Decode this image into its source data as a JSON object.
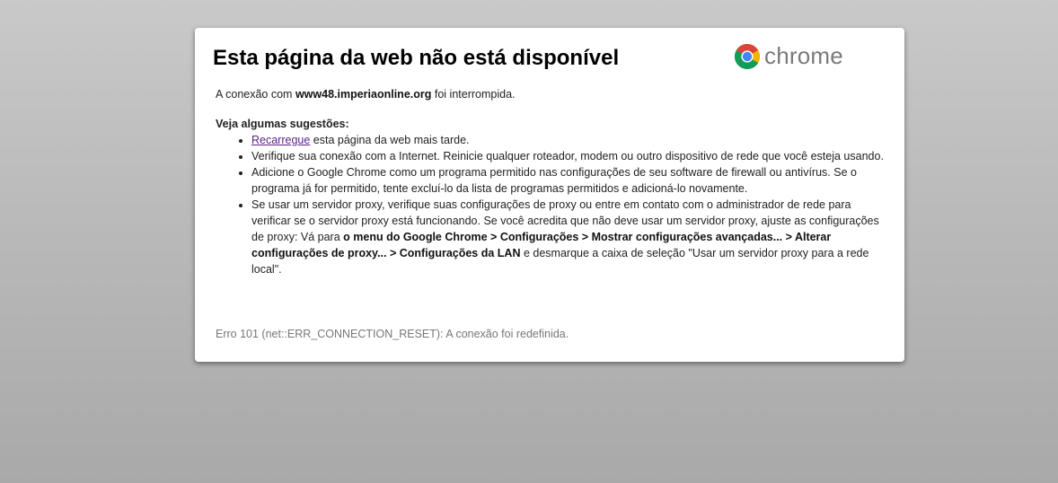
{
  "page": {
    "title": "Esta página da web não está disponível",
    "logo_text": "chrome",
    "logo_icon": "chrome-logo-icon"
  },
  "connection": {
    "prefix": "A conexão com ",
    "host": "www48.imperiaonline.org",
    "suffix": " foi interrompida."
  },
  "suggestions": {
    "heading": "Veja algumas sugestões:",
    "reload": {
      "link": "Recarregue",
      "text": " esta página da web mais tarde."
    },
    "check_connection": "Verifique sua conexão com a Internet. Reinicie qualquer roteador, modem ou outro dispositivo de rede que você esteja usando.",
    "firewall": "Adicione o Google Chrome como um programa permitido nas configurações de seu software de firewall ou antivírus. Se o programa já for permitido, tente excluí-lo da lista de programas permitidos e adicioná-lo novamente.",
    "proxy": {
      "part1": "Se usar um servidor proxy, verifique suas configurações de proxy ou entre em contato com o administrador de rede para verificar se o servidor proxy está funcionando. Se você acredita que não deve usar um servidor proxy, ajuste as configurações de proxy: Vá para ",
      "path": "o menu do Google Chrome > Configurações > Mostrar configurações avançadas... > Alterar configurações de proxy... > Configurações da LAN",
      "part2": " e desmarque a caixa de seleção \"Usar um servidor proxy para a rede local\"."
    }
  },
  "error": {
    "text": "Erro 101 (net::ERR_CONNECTION_RESET): A conexão foi redefinida."
  },
  "colors": {
    "background": "#b8b8b8",
    "card": "#ffffff",
    "link": "#5a1f8a",
    "error_text": "#777777",
    "logo_text": "#7a7a7a"
  }
}
